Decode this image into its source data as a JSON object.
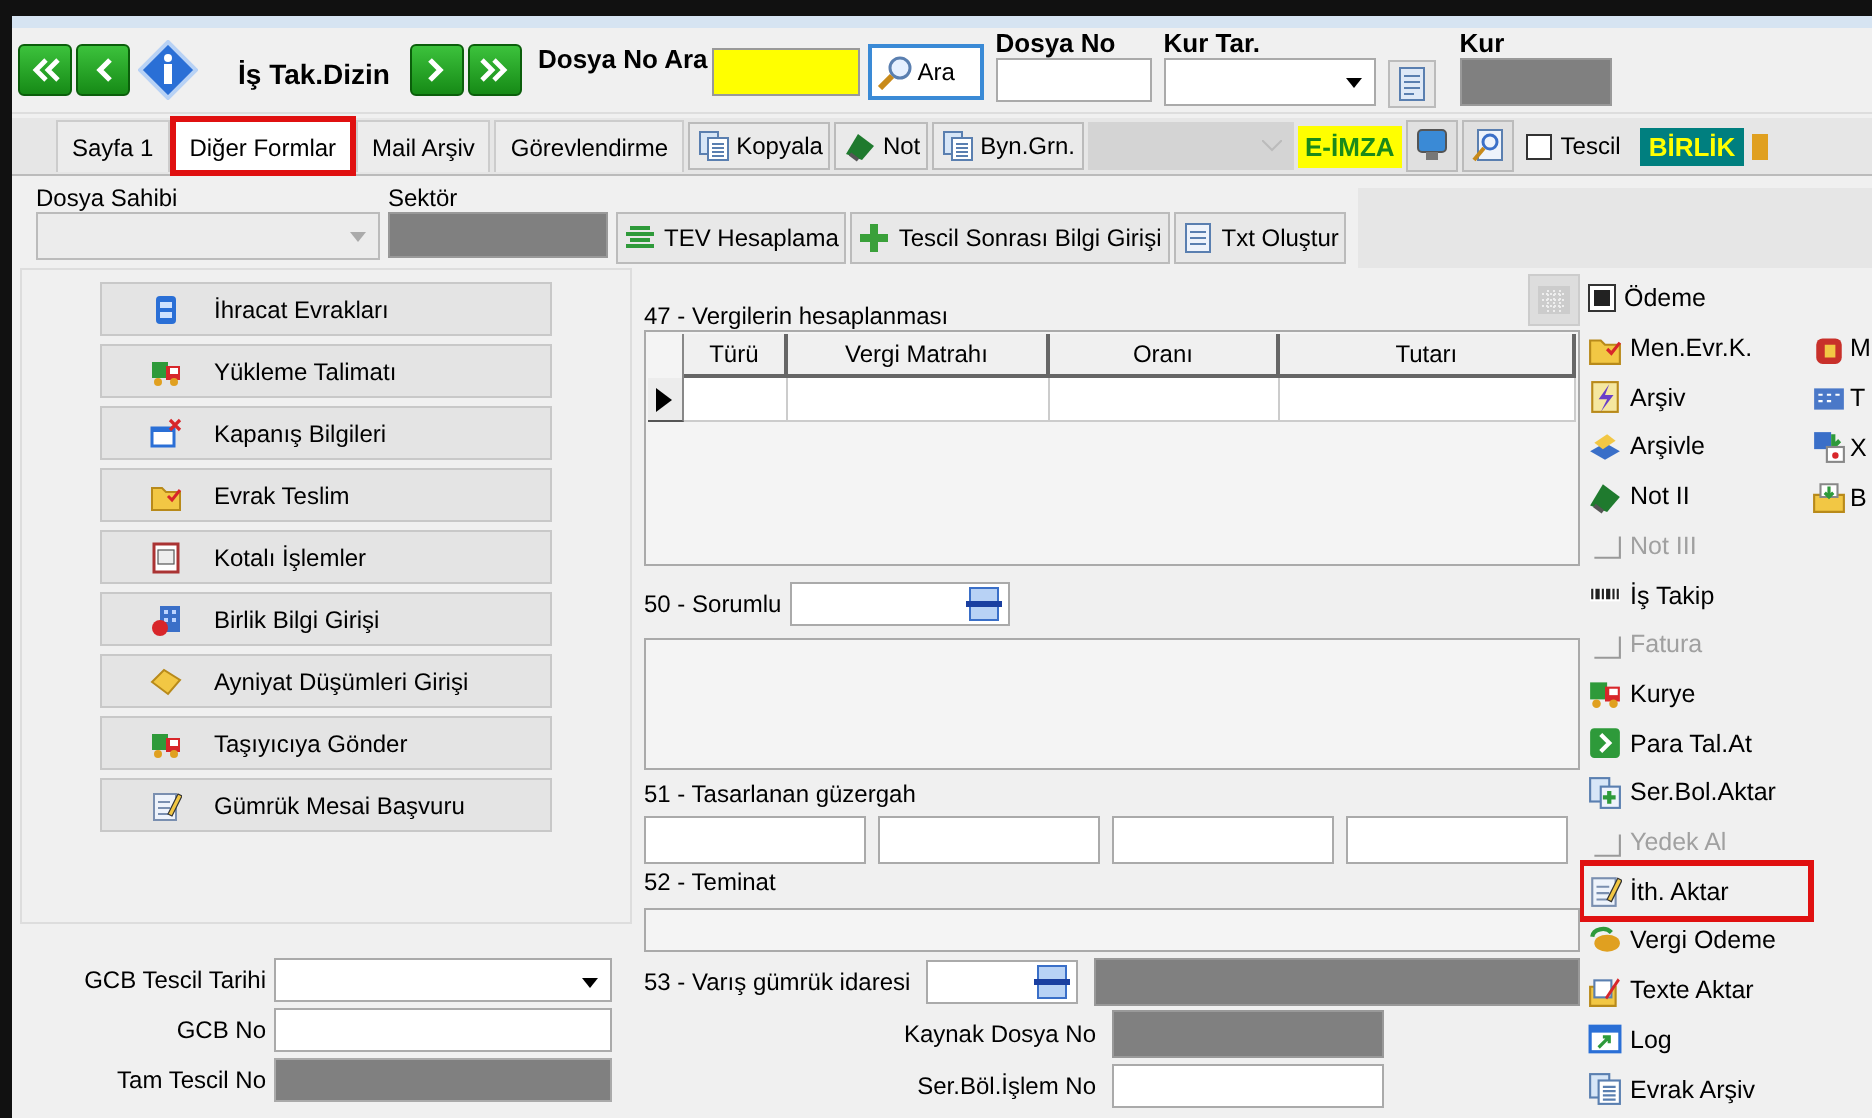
{
  "toolbar": {
    "caption": "İş Tak.Dizin",
    "search_label": "Dosya No Ara",
    "search_button": "Ara",
    "dosya_no_label": "Dosya No",
    "kur_tar_label": "Kur Tar.",
    "kur_label": "Kur"
  },
  "tabs": [
    {
      "label": "Sayfa 1",
      "selected": false,
      "highlighted": false
    },
    {
      "label": "Diğer Formlar",
      "selected": true,
      "highlighted": true
    },
    {
      "label": "Mail Arşiv",
      "selected": false,
      "highlighted": false
    },
    {
      "label": "Görevlendirme",
      "selected": false,
      "highlighted": false
    }
  ],
  "tab_bar_buttons": [
    "Kopyala",
    "Not",
    "Byn.Grn."
  ],
  "e_imza": "E-İMZA",
  "tescil_checkbox": {
    "label": "Tescil",
    "checked": false
  },
  "birlik": "BİRLİK",
  "dosya_sahibi_label": "Dosya Sahibi",
  "sektor_label": "Sektör",
  "action_buttons": [
    "TEV Hesaplama",
    "Tescil Sonrası Bilgi Girişi",
    "Txt Oluştur"
  ],
  "forms": [
    "İhracat Evrakları",
    "Yükleme Talimatı",
    "Kapanış Bilgileri",
    "Evrak Teslim",
    "Kotalı İşlemler",
    "Birlik Bilgi Girişi",
    "Ayniyat Düşümleri Girişi",
    "Taşıyıcıya Gönder",
    "Gümrük Mesai Başvuru"
  ],
  "gcb_fields": [
    {
      "label": "GCB Tescil Tarihi",
      "kind": "date"
    },
    {
      "label": "GCB No",
      "kind": "text"
    },
    {
      "label": "Tam Tescil No",
      "kind": "readonly"
    }
  ],
  "box47": {
    "title": "47 - Vergilerin hesaplanması",
    "columns": [
      "Türü",
      "Vergi Matrahı",
      "Oranı",
      "Tutarı"
    ]
  },
  "box50_label": "50 - Sorumlu",
  "box51_label": "51 - Tasarlanan güzergah",
  "box52_label": "52 - Teminat",
  "box53_label": "53 - Varış gümrük idaresi",
  "kaynak_label": "Kaynak Dosya No",
  "ser_bol_label": "Ser.Böl.İşlem No",
  "side_menu": [
    {
      "label": "Ödeme",
      "kind": "checkbox",
      "checked": true,
      "disabled": false,
      "highlighted": false
    },
    {
      "label": "Men.Evr.K.",
      "kind": "button",
      "disabled": false,
      "highlighted": false
    },
    {
      "label": "Arşiv",
      "kind": "button",
      "disabled": false,
      "highlighted": false
    },
    {
      "label": "Arşivle",
      "kind": "button",
      "disabled": false,
      "highlighted": false
    },
    {
      "label": "Not II",
      "kind": "button",
      "disabled": false,
      "highlighted": false
    },
    {
      "label": "Not III",
      "kind": "button",
      "disabled": true,
      "highlighted": false
    },
    {
      "label": "İş Takip",
      "kind": "button",
      "disabled": false,
      "highlighted": false
    },
    {
      "label": "Fatura",
      "kind": "button",
      "disabled": true,
      "highlighted": false
    },
    {
      "label": "Kurye",
      "kind": "button",
      "disabled": false,
      "highlighted": false
    },
    {
      "label": "Para Tal.At",
      "kind": "button",
      "disabled": false,
      "highlighted": false
    },
    {
      "label": "Ser.Bol.Aktar",
      "kind": "button",
      "disabled": false,
      "highlighted": false
    },
    {
      "label": "Yedek Al",
      "kind": "button",
      "disabled": true,
      "highlighted": false
    },
    {
      "label": "İth. Aktar",
      "kind": "button",
      "disabled": false,
      "highlighted": true
    },
    {
      "label": "Vergi Odeme",
      "kind": "button",
      "disabled": false,
      "highlighted": false
    },
    {
      "label": "Texte Aktar",
      "kind": "button",
      "disabled": false,
      "highlighted": false
    },
    {
      "label": "Log",
      "kind": "button",
      "disabled": false,
      "highlighted": false
    },
    {
      "label": "Evrak Arşiv",
      "kind": "button",
      "disabled": false,
      "highlighted": false
    }
  ],
  "side_menu_2": [
    "M",
    "T",
    "X",
    "B"
  ]
}
